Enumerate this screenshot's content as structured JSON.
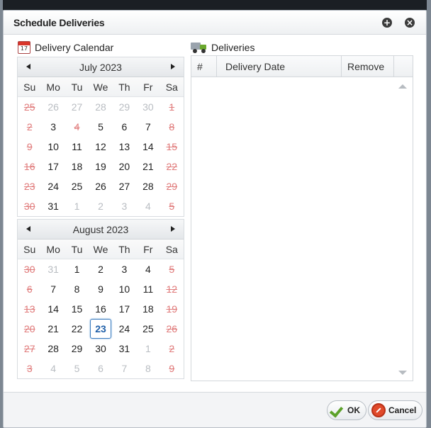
{
  "dialog": {
    "title": "Schedule Deliveries",
    "add_icon": "+",
    "close_icon": "×"
  },
  "calendar_section": {
    "title": "Delivery Calendar",
    "icon_day": "17"
  },
  "deliveries_section": {
    "title": "Deliveries",
    "columns": [
      "#",
      "Delivery Date",
      "Remove"
    ]
  },
  "weekdays": [
    "Su",
    "Mo",
    "Tu",
    "We",
    "Th",
    "Fr",
    "Sa"
  ],
  "calendars": [
    {
      "month": "July 2023",
      "days": [
        {
          "d": "25",
          "t": "weekend-other"
        },
        {
          "d": "26",
          "t": "other"
        },
        {
          "d": "27",
          "t": "other"
        },
        {
          "d": "28",
          "t": "other"
        },
        {
          "d": "29",
          "t": "other"
        },
        {
          "d": "30",
          "t": "other"
        },
        {
          "d": "1",
          "t": "weekend"
        },
        {
          "d": "2",
          "t": "weekend"
        },
        {
          "d": "3",
          "t": "normal"
        },
        {
          "d": "4",
          "t": "weekend"
        },
        {
          "d": "5",
          "t": "normal"
        },
        {
          "d": "6",
          "t": "normal"
        },
        {
          "d": "7",
          "t": "normal"
        },
        {
          "d": "8",
          "t": "weekend"
        },
        {
          "d": "9",
          "t": "weekend"
        },
        {
          "d": "10",
          "t": "normal"
        },
        {
          "d": "11",
          "t": "normal"
        },
        {
          "d": "12",
          "t": "normal"
        },
        {
          "d": "13",
          "t": "normal"
        },
        {
          "d": "14",
          "t": "normal"
        },
        {
          "d": "15",
          "t": "weekend"
        },
        {
          "d": "16",
          "t": "weekend"
        },
        {
          "d": "17",
          "t": "normal"
        },
        {
          "d": "18",
          "t": "normal"
        },
        {
          "d": "19",
          "t": "normal"
        },
        {
          "d": "20",
          "t": "normal"
        },
        {
          "d": "21",
          "t": "normal"
        },
        {
          "d": "22",
          "t": "weekend"
        },
        {
          "d": "23",
          "t": "weekend"
        },
        {
          "d": "24",
          "t": "normal"
        },
        {
          "d": "25",
          "t": "normal"
        },
        {
          "d": "26",
          "t": "normal"
        },
        {
          "d": "27",
          "t": "normal"
        },
        {
          "d": "28",
          "t": "normal"
        },
        {
          "d": "29",
          "t": "weekend"
        },
        {
          "d": "30",
          "t": "weekend"
        },
        {
          "d": "31",
          "t": "normal"
        },
        {
          "d": "1",
          "t": "other"
        },
        {
          "d": "2",
          "t": "other"
        },
        {
          "d": "3",
          "t": "other"
        },
        {
          "d": "4",
          "t": "other"
        },
        {
          "d": "5",
          "t": "weekend"
        }
      ]
    },
    {
      "month": "August 2023",
      "days": [
        {
          "d": "30",
          "t": "weekend"
        },
        {
          "d": "31",
          "t": "other"
        },
        {
          "d": "1",
          "t": "normal"
        },
        {
          "d": "2",
          "t": "normal"
        },
        {
          "d": "3",
          "t": "normal"
        },
        {
          "d": "4",
          "t": "normal"
        },
        {
          "d": "5",
          "t": "weekend"
        },
        {
          "d": "6",
          "t": "weekend"
        },
        {
          "d": "7",
          "t": "normal"
        },
        {
          "d": "8",
          "t": "normal"
        },
        {
          "d": "9",
          "t": "normal"
        },
        {
          "d": "10",
          "t": "normal"
        },
        {
          "d": "11",
          "t": "normal"
        },
        {
          "d": "12",
          "t": "weekend"
        },
        {
          "d": "13",
          "t": "weekend"
        },
        {
          "d": "14",
          "t": "normal"
        },
        {
          "d": "15",
          "t": "normal"
        },
        {
          "d": "16",
          "t": "normal"
        },
        {
          "d": "17",
          "t": "normal"
        },
        {
          "d": "18",
          "t": "normal"
        },
        {
          "d": "19",
          "t": "weekend"
        },
        {
          "d": "20",
          "t": "weekend"
        },
        {
          "d": "21",
          "t": "normal"
        },
        {
          "d": "22",
          "t": "normal"
        },
        {
          "d": "23",
          "t": "today"
        },
        {
          "d": "24",
          "t": "normal"
        },
        {
          "d": "25",
          "t": "normal"
        },
        {
          "d": "26",
          "t": "weekend"
        },
        {
          "d": "27",
          "t": "weekend"
        },
        {
          "d": "28",
          "t": "normal"
        },
        {
          "d": "29",
          "t": "normal"
        },
        {
          "d": "30",
          "t": "normal"
        },
        {
          "d": "31",
          "t": "normal"
        },
        {
          "d": "1",
          "t": "other"
        },
        {
          "d": "2",
          "t": "weekend"
        },
        {
          "d": "3",
          "t": "weekend"
        },
        {
          "d": "4",
          "t": "other"
        },
        {
          "d": "5",
          "t": "other"
        },
        {
          "d": "6",
          "t": "other"
        },
        {
          "d": "7",
          "t": "other"
        },
        {
          "d": "8",
          "t": "other"
        },
        {
          "d": "9",
          "t": "weekend"
        }
      ]
    }
  ],
  "footer": {
    "ok_label": "OK",
    "cancel_label": "Cancel"
  }
}
